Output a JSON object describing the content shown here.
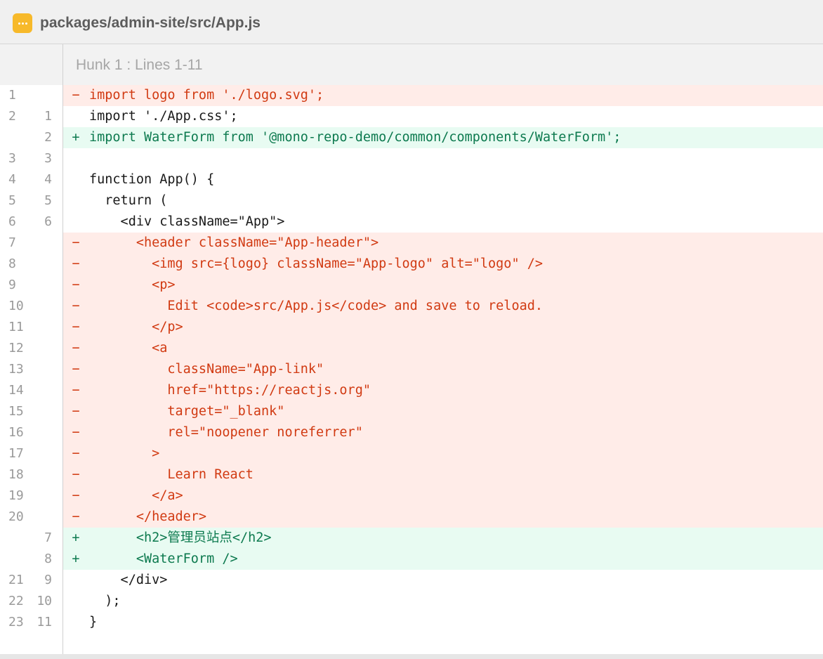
{
  "file": {
    "path": "packages/admin-site/src/App.js",
    "icon": "ellipsis-icon",
    "icon_color": "#f7b92a"
  },
  "hunk": {
    "label": "Hunk 1 : Lines 1-11"
  },
  "colors": {
    "deleted_bg": "#ffece8",
    "deleted_text": "#d13a12",
    "added_bg": "#e8fbf2",
    "added_text": "#0d7a4f"
  },
  "lines": [
    {
      "type": "del",
      "old": "1",
      "new": "",
      "marker": "−",
      "code": "import logo from './logo.svg';"
    },
    {
      "type": "ctx",
      "old": "2",
      "new": "1",
      "marker": "",
      "code": "import './App.css';"
    },
    {
      "type": "add",
      "old": "",
      "new": "2",
      "marker": "+",
      "code": "import WaterForm from '@mono-repo-demo/common/components/WaterForm';"
    },
    {
      "type": "ctx",
      "old": "3",
      "new": "3",
      "marker": "",
      "code": ""
    },
    {
      "type": "ctx",
      "old": "4",
      "new": "4",
      "marker": "",
      "code": "function App() {"
    },
    {
      "type": "ctx",
      "old": "5",
      "new": "5",
      "marker": "",
      "code": "  return ("
    },
    {
      "type": "ctx",
      "old": "6",
      "new": "6",
      "marker": "",
      "code": "    <div className=\"App\">"
    },
    {
      "type": "del",
      "old": "7",
      "new": "",
      "marker": "−",
      "code": "      <header className=\"App-header\">"
    },
    {
      "type": "del",
      "old": "8",
      "new": "",
      "marker": "−",
      "code": "        <img src={logo} className=\"App-logo\" alt=\"logo\" />"
    },
    {
      "type": "del",
      "old": "9",
      "new": "",
      "marker": "−",
      "code": "        <p>"
    },
    {
      "type": "del",
      "old": "10",
      "new": "",
      "marker": "−",
      "code": "          Edit <code>src/App.js</code> and save to reload."
    },
    {
      "type": "del",
      "old": "11",
      "new": "",
      "marker": "−",
      "code": "        </p>"
    },
    {
      "type": "del",
      "old": "12",
      "new": "",
      "marker": "−",
      "code": "        <a"
    },
    {
      "type": "del",
      "old": "13",
      "new": "",
      "marker": "−",
      "code": "          className=\"App-link\""
    },
    {
      "type": "del",
      "old": "14",
      "new": "",
      "marker": "−",
      "code": "          href=\"https://reactjs.org\""
    },
    {
      "type": "del",
      "old": "15",
      "new": "",
      "marker": "−",
      "code": "          target=\"_blank\""
    },
    {
      "type": "del",
      "old": "16",
      "new": "",
      "marker": "−",
      "code": "          rel=\"noopener noreferrer\""
    },
    {
      "type": "del",
      "old": "17",
      "new": "",
      "marker": "−",
      "code": "        >"
    },
    {
      "type": "del",
      "old": "18",
      "new": "",
      "marker": "−",
      "code": "          Learn React"
    },
    {
      "type": "del",
      "old": "19",
      "new": "",
      "marker": "−",
      "code": "        </a>"
    },
    {
      "type": "del",
      "old": "20",
      "new": "",
      "marker": "−",
      "code": "      </header>"
    },
    {
      "type": "add",
      "old": "",
      "new": "7",
      "marker": "+",
      "code": "      <h2>管理员站点</h2>"
    },
    {
      "type": "add",
      "old": "",
      "new": "8",
      "marker": "+",
      "code": "      <WaterForm />"
    },
    {
      "type": "ctx",
      "old": "21",
      "new": "9",
      "marker": "",
      "code": "    </div>"
    },
    {
      "type": "ctx",
      "old": "22",
      "new": "10",
      "marker": "",
      "code": "  );"
    },
    {
      "type": "ctx",
      "old": "23",
      "new": "11",
      "marker": "",
      "code": "}"
    }
  ]
}
